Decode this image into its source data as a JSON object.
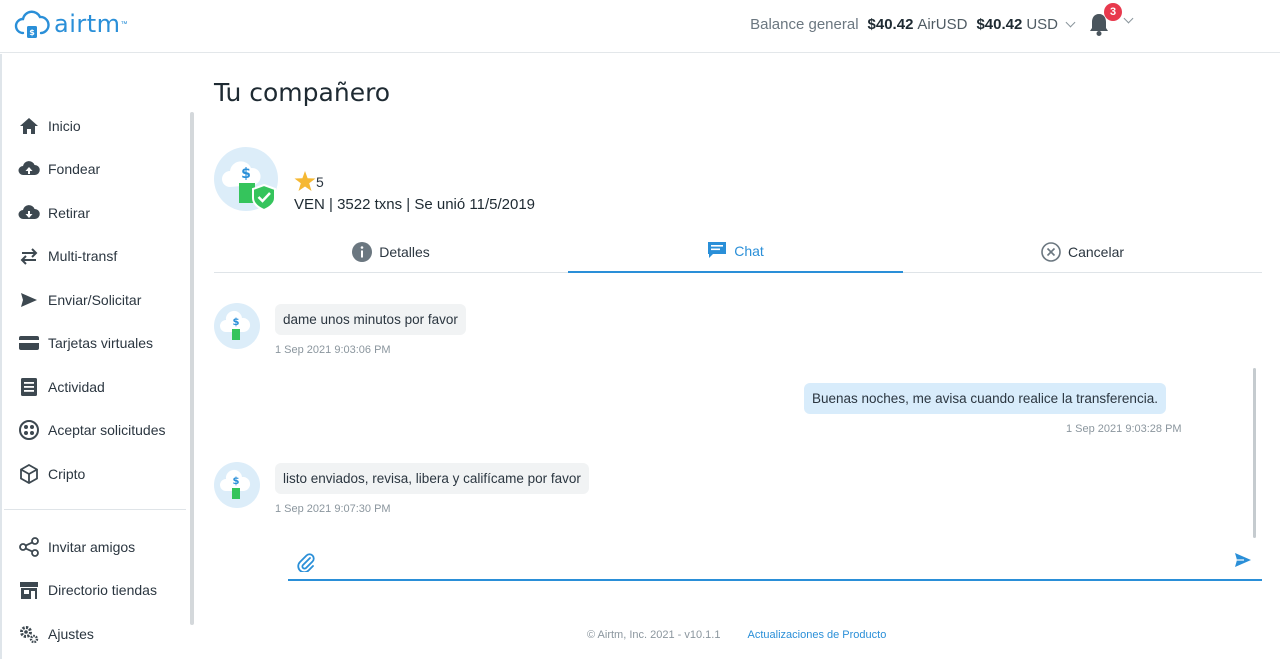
{
  "brand": {
    "name": "airtm",
    "tm": "™"
  },
  "header": {
    "balance_label": "Balance general",
    "balance_airusd": "$40.42",
    "currency_airusd": "AirUSD",
    "balance_usd": "$40.42",
    "currency_usd": "USD",
    "notification_count": "3"
  },
  "sidebar": {
    "items": [
      {
        "label": "Inicio",
        "icon": "home-icon"
      },
      {
        "label": "Fondear",
        "icon": "cloud-upload-icon"
      },
      {
        "label": "Retirar",
        "icon": "cloud-download-icon"
      },
      {
        "label": "Multi-transf",
        "icon": "swap-arrows-icon"
      },
      {
        "label": "Enviar/Solicitar",
        "icon": "send-icon"
      },
      {
        "label": "Tarjetas virtuales",
        "icon": "credit-card-icon"
      },
      {
        "label": "Actividad",
        "icon": "document-list-icon"
      },
      {
        "label": "Aceptar solicitudes",
        "icon": "grid-circle-icon"
      },
      {
        "label": "Cripto",
        "icon": "cube-icon"
      }
    ],
    "secondary": [
      {
        "label": "Invitar amigos",
        "icon": "share-icon"
      },
      {
        "label": "Directorio tiendas",
        "icon": "store-icon"
      },
      {
        "label": "Ajustes",
        "icon": "gears-icon"
      }
    ]
  },
  "page": {
    "title": "Tu compañero",
    "rating": "5",
    "partner_info": "VEN | 3522 txns | Se unió 11/5/2019"
  },
  "tabs": {
    "details": "Detalles",
    "chat": "Chat",
    "cancel": "Cancelar"
  },
  "chat": {
    "messages": [
      {
        "direction": "in",
        "text": "dame unos minutos por favor",
        "time": "1 Sep 2021 9:03:06 PM"
      },
      {
        "direction": "out",
        "text": "Buenas noches, me avisa cuando realice la transferencia.",
        "time": "1 Sep 2021 9:03:28 PM"
      },
      {
        "direction": "in",
        "text": "listo enviados, revisa, libera y califícame por favor",
        "time": "1 Sep 2021 9:07:30 PM"
      }
    ],
    "input_value": "",
    "input_placeholder": ""
  },
  "footer": {
    "copyright": "© Airtm, Inc. 2021 - v10.1.1",
    "link": "Actualizaciones de Producto"
  },
  "colors": {
    "accent": "#2a8fd8",
    "badge": "#e8394d",
    "star": "#f5b833",
    "green": "#35c45c"
  }
}
